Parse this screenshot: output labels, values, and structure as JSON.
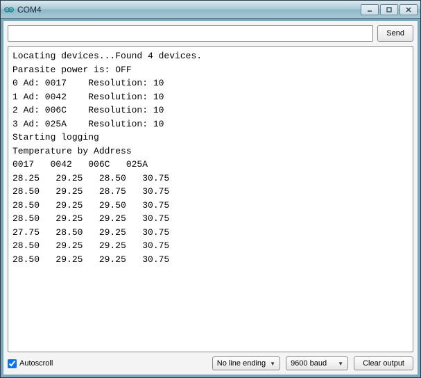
{
  "window": {
    "title": "COM4"
  },
  "toolbar": {
    "send_label": "Send",
    "input_value": ""
  },
  "console": {
    "header_lines": [
      "Locating devices...Found 4 devices.",
      "Parasite power is: OFF"
    ],
    "devices": [
      {
        "idx": 0,
        "addr": "0017",
        "res": 10
      },
      {
        "idx": 1,
        "addr": "0042",
        "res": 10
      },
      {
        "idx": 2,
        "addr": "006C",
        "res": 10
      },
      {
        "idx": 3,
        "addr": "025A",
        "res": 10
      }
    ],
    "starting_line": "Starting logging",
    "temp_header": "Temperature by Address",
    "addr_columns": [
      "0017",
      "0042",
      "006C",
      "025A"
    ],
    "rows": [
      [
        28.25,
        29.25,
        28.5,
        30.75
      ],
      [
        28.5,
        29.25,
        28.75,
        30.75
      ],
      [
        28.5,
        29.25,
        29.5,
        30.75
      ],
      [
        28.5,
        29.25,
        29.25,
        30.75
      ],
      [
        27.75,
        28.5,
        29.25,
        30.75
      ],
      [
        28.5,
        29.25,
        29.25,
        30.75
      ],
      [
        28.5,
        29.25,
        29.25,
        30.75
      ]
    ]
  },
  "footer": {
    "autoscroll_label": "Autoscroll",
    "autoscroll_checked": true,
    "line_ending": "No line ending",
    "baud": "9600 baud",
    "clear_label": "Clear output"
  }
}
